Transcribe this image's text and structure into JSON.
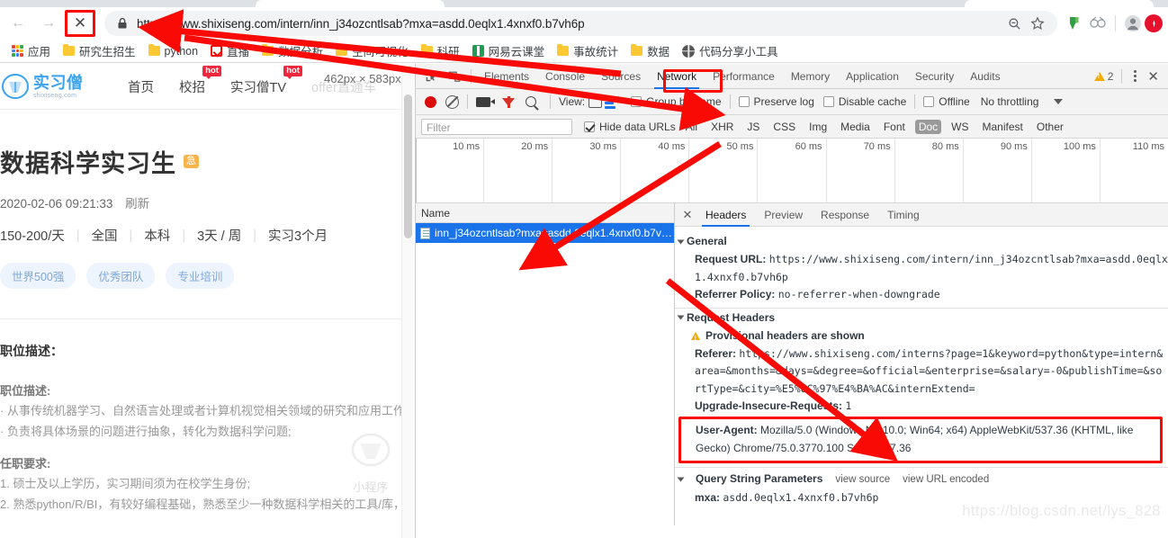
{
  "browser": {
    "nav": {
      "back": "←",
      "forward": "→",
      "stop": "✕"
    },
    "omnibox": {
      "scheme": "https://",
      "url_rest": "www.shixiseng.com/intern/inn_j34ozcntlsab?mxa=asdd.0eqlx1.4xnxf0.b7vh6p",
      "full_url": "https://www.shixiseng.com/intern/inn_j34ozcntlsab?mxa=asdd.0eqlx1.4xnxf0.b7vh6p",
      "lock_icon": "lock-icon",
      "zoom_icon": "zoom-out-icon",
      "star_icon": "bookmark-star-icon"
    },
    "bookmarks": [
      {
        "label": "应用",
        "icon": "apps-grid-icon"
      },
      {
        "label": "研究生招生",
        "icon": "folder-icon"
      },
      {
        "label": "python",
        "icon": "folder-icon"
      },
      {
        "label": "直播",
        "icon": "red-favicon"
      },
      {
        "label": "数据分析",
        "icon": "folder-icon"
      },
      {
        "label": "空间可视化",
        "icon": "folder-icon"
      },
      {
        "label": "科研",
        "icon": "folder-icon"
      },
      {
        "label": "网易云课堂",
        "icon": "green-favicon"
      },
      {
        "label": "事故统计",
        "icon": "folder-icon"
      },
      {
        "label": "数据",
        "icon": "folder-icon"
      },
      {
        "label": "代码分享小工具",
        "icon": "globe-favicon"
      }
    ]
  },
  "page": {
    "logo": {
      "cn": "实习僧",
      "en": "shixiseng.com"
    },
    "nav": [
      {
        "label": "首页",
        "badge": ""
      },
      {
        "label": "校招",
        "badge": "hot"
      },
      {
        "label": "实习僧TV",
        "badge": "hot"
      },
      {
        "label": "offer直通车",
        "badge": ""
      }
    ],
    "dimension_tooltip": "462px × 583px",
    "job_title": "数据科学实习生",
    "urgent_badge": "急",
    "posted_time": "2020-02-06 09:21:33",
    "refresh_label": "刷新",
    "facts": [
      "150-200/天",
      "全国",
      "本科",
      "3天 / 周",
      "实习3个月"
    ],
    "tags": [
      "世界500强",
      "优秀团队",
      "专业培训"
    ],
    "section_title": "职位描述：",
    "desc_heading": "职位描述:",
    "desc_items": [
      "· 从事传统机器学习、自然语言处理或者计算机视觉相关领域的研究和应用工作;",
      "· 负责将具体场景的问题进行抽象，转化为数据科学问题;"
    ],
    "req_heading": "任职要求:",
    "req_items": [
      "1. 硕士及以上学历，实习期间须为在校学生身份;",
      "2. 熟悉python/R/BI，有较好编程基础，熟悉至少一种数据科学相关的工具/库，"
    ],
    "mini_watermark": "小程序"
  },
  "devtools": {
    "tabs": [
      "Elements",
      "Console",
      "Sources",
      "Network",
      "Performance",
      "Memory",
      "Application",
      "Security",
      "Audits"
    ],
    "active_tab": "Network",
    "warning_count": "2",
    "close_label": "✕",
    "network_toolbar": {
      "record_icon": "record-dot-icon",
      "clear_icon": "clear-icon",
      "capture_screenshots_icon": "camera-icon",
      "filter_icon": "funnel-icon",
      "search_icon": "search-icon",
      "view_label": "View:",
      "group_by_frame": "Group by frame",
      "preserve_log": "Preserve log",
      "disable_cache": "Disable cache",
      "offline": "Offline",
      "throttling": "No throttling"
    },
    "filter_bar": {
      "filter_placeholder": "Filter",
      "hide_data_urls": "Hide data URLs",
      "types": [
        "All",
        "XHR",
        "JS",
        "CSS",
        "Img",
        "Media",
        "Font",
        "Doc",
        "WS",
        "Manifest",
        "Other"
      ],
      "selected_type": "Doc"
    },
    "timeline_ticks": [
      "10 ms",
      "20 ms",
      "30 ms",
      "40 ms",
      "50 ms",
      "60 ms",
      "70 ms",
      "80 ms",
      "90 ms",
      "100 ms",
      "110 ms"
    ],
    "request_list": {
      "column_header": "Name",
      "rows": [
        {
          "name": "inn_j34ozcntlsab?mxa=asdd.0eqlx1.4xnxf0.b7v…",
          "selected": true,
          "icon": "document-icon"
        }
      ]
    },
    "detail": {
      "tabs": [
        "Headers",
        "Preview",
        "Response",
        "Timing"
      ],
      "active_tab": "Headers",
      "sections": {
        "general": {
          "title": "General",
          "request_url_key": "Request URL:",
          "request_url_value": "https://www.shixiseng.com/intern/inn_j34ozcntlsab?mxa=asdd.0eqlx1.4xnxf0.b7vh6p",
          "referrer_policy_key": "Referrer Policy:",
          "referrer_policy_value": "no-referrer-when-downgrade"
        },
        "request_headers": {
          "title": "Request Headers",
          "provisional_warning": "Provisional headers are shown",
          "referer_key": "Referer:",
          "referer_value": "https://www.shixiseng.com/interns?page=1&keyword=python&type=intern&area=&months=&days=&degree=&official=&enterprise=&salary=-0&publishTime=&sortType=&city=%E5%8C%97%E4%BA%AC&internExtend=",
          "upgrade_key": "Upgrade-Insecure-Requests:",
          "upgrade_value": "1",
          "user_agent_key": "User-Agent:",
          "user_agent_value": "Mozilla/5.0 (Windows NT 10.0; Win64; x64) AppleWebKit/537.36 (KHTML, like Gecko) Chrome/75.0.3770.100 Safari/537.36"
        },
        "query_string": {
          "title": "Query String Parameters",
          "view_source": "view source",
          "view_url_encoded": "view URL encoded",
          "params": [
            {
              "key": "mxa:",
              "value": "asdd.0eqlx1.4xnxf0.b7vh6p"
            }
          ]
        }
      }
    }
  },
  "watermark": "https://blog.csdn.net/lys_828",
  "colors": {
    "accent_blue": "#1a73e8",
    "annotation_red": "#fa0a05",
    "warning_yellow": "#f2ab00",
    "record_red": "#db0b0b"
  }
}
